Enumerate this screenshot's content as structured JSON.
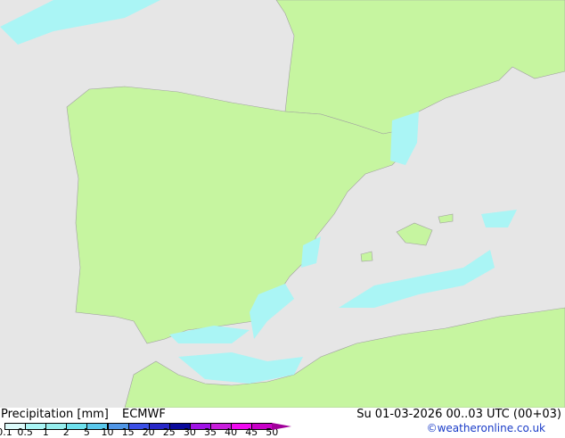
{
  "title": "Precipitation [mm]",
  "model": "ECMWF",
  "datetime": "Su 01-03-2026 00..03 UTC (00+03)",
  "credit": "©weatheronline.co.uk",
  "colors": {
    "sea": "#e6e6e6",
    "land": "#c6f5a0",
    "coast": "#a0a0a0",
    "border": "#a0a0a0"
  },
  "legend": {
    "ticks": [
      "0.1",
      "0.5",
      "1",
      "2",
      "5",
      "10",
      "15",
      "20",
      "25",
      "30",
      "35",
      "40",
      "45",
      "50"
    ],
    "colors": [
      "#dcfafa",
      "#aaf5f5",
      "#96eeee",
      "#6ee1ee",
      "#5ac8ec",
      "#5096e6",
      "#3c50e6",
      "#2828c8",
      "#0a0a9c",
      "#a014e6",
      "#c81edc",
      "#f00af0",
      "#c800c8",
      "#a0009a"
    ]
  }
}
